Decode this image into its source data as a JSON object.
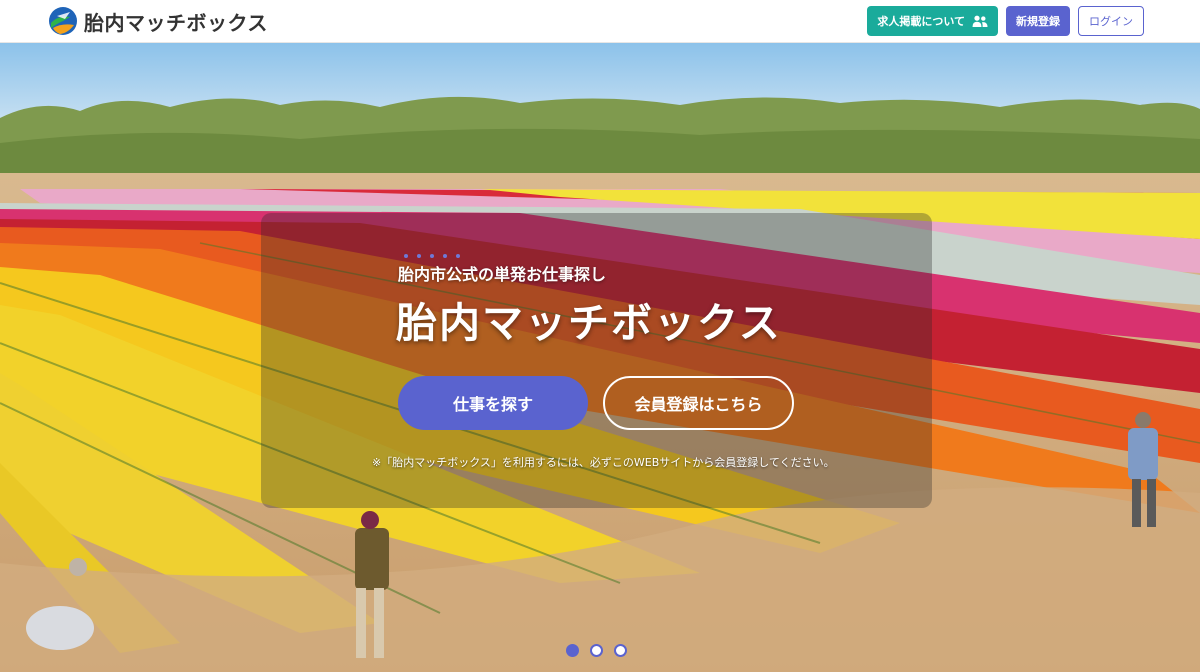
{
  "colors": {
    "teal": "#1aab9b",
    "indigo": "#5a63cf"
  },
  "header": {
    "logo_text": "胎内マッチボックス",
    "logo_icon": "tainai-logo-icon",
    "post_job_label": "求人掲載について",
    "post_job_icon": "people-icon",
    "signup_label": "新規登録",
    "login_label": "ログイン"
  },
  "hero": {
    "subtitle": "胎内市公式の単発お仕事探し",
    "title": "胎内マッチボックス",
    "search_label": "仕事を探す",
    "register_label": "会員登録はこちら",
    "note": "※「胎内マッチボックス」を利用するには、必ずこのWEBサイトから会員登録してください。",
    "slides": {
      "count": 3,
      "active": 1
    }
  }
}
